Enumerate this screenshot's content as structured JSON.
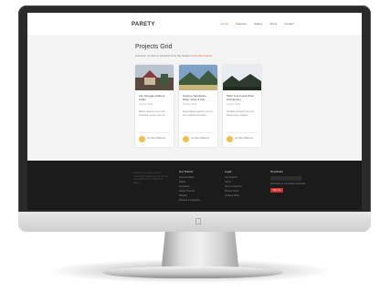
{
  "site": {
    "logo": "PARETY",
    "nav_links": [
      "Home",
      "Features",
      "Gallery",
      "About",
      "Contact"
    ],
    "nav_active_index": 0,
    "accent_color": "#e56a3a"
  },
  "page": {
    "title": "Projects Grid",
    "subtitle_prefix": "A section of various products from the Nearest",
    "subtitle_link": "View all projects",
    "cards": [
      {
        "title": "Life Struggle Gathers Cabin",
        "date": "October 2014",
        "excerpt": "Mauris pharetra nunc quis bibendum auctor sem nec.",
        "author": "Jennifer Patterson",
        "avatar_color": "#f2c24a"
      },
      {
        "title": "Capture Sandstone Natur Voice & City",
        "date": "October 2014",
        "excerpt": "Suspendisse egestas nunc id sem vehicula imperdiet.",
        "author": "Jennifer Patterson",
        "avatar_color": "#f2c24a"
      },
      {
        "title": "5000 Year Fossil Work Architecture",
        "date": "October 2014",
        "excerpt": "Curabitur tincidunt nisi quis ligula ornare sodales.",
        "author": "Jennifer Patterson",
        "avatar_color": "#f2c24a"
      }
    ]
  },
  "footer": {
    "about": "Lorem ipsum dolor sit amet, consectetur adipiscing elit. Sed do eiusmod tempor incididunt ut labore.",
    "col1": {
      "heading": "Get Started",
      "items": [
        "Documentation",
        "Pages",
        "Templates",
        "Starter Themes",
        "Widgets",
        "Release & Upgrades"
      ]
    },
    "col2": {
      "heading": "Legal",
      "items": [
        "Our Support",
        "Terms",
        "Terms of Service",
        "Privacy Policy",
        "Cookies Policy"
      ]
    },
    "col3": {
      "heading": "Newsletter",
      "checkbox_label": "Subscribe to our weekly newsletter",
      "button": "Sign Up"
    }
  }
}
